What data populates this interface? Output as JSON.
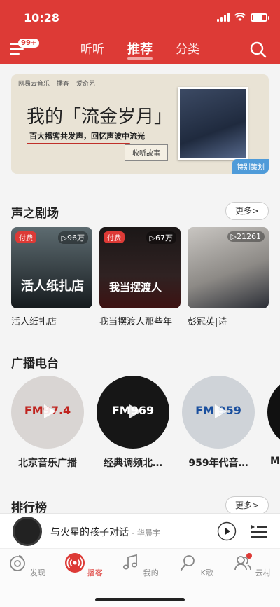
{
  "status": {
    "time": "10:28"
  },
  "header": {
    "badge": "99+",
    "tabs": [
      "听听",
      "推荐",
      "分类"
    ],
    "active_tab": "推荐"
  },
  "banner": {
    "logos": [
      "网易云音乐",
      "播客",
      "爱奇艺"
    ],
    "title": "我的「流金岁月」",
    "subtitle": "百大播客共发声，回忆声波中流光",
    "button": "收听故事",
    "tag": "特别策划"
  },
  "drama": {
    "title": "声之剧场",
    "more": "更多>",
    "items": [
      {
        "title": "活人纸扎店",
        "paid": "付费",
        "plays": "▷96万",
        "cover_text": "活人纸扎店"
      },
      {
        "title": "我当摆渡人那些年",
        "paid": "付费",
        "plays": "▷67万",
        "cover_text": "我当摆渡人"
      },
      {
        "title": "彭冠英|诗",
        "paid": "",
        "plays": "▷21261",
        "cover_text": ""
      }
    ]
  },
  "radio": {
    "title": "广播电台",
    "items": [
      {
        "title": "北京音乐广播",
        "logo": "FM97.4"
      },
      {
        "title": "经典调频北…",
        "logo": "FM969"
      },
      {
        "title": "959年代音…",
        "logo": "FM 959"
      },
      {
        "title": "M",
        "logo": ""
      }
    ]
  },
  "ranking": {
    "title": "排行榜",
    "more": "更多>"
  },
  "player": {
    "title": "与火星的孩子对话",
    "artist": "- 华晨宇"
  },
  "tabbar": {
    "items": [
      "发现",
      "播客",
      "我的",
      "K歌",
      "云村"
    ],
    "active": "播客"
  },
  "colors": {
    "brand": "#dd3a36",
    "accent_blue": "#4f9bd9"
  }
}
